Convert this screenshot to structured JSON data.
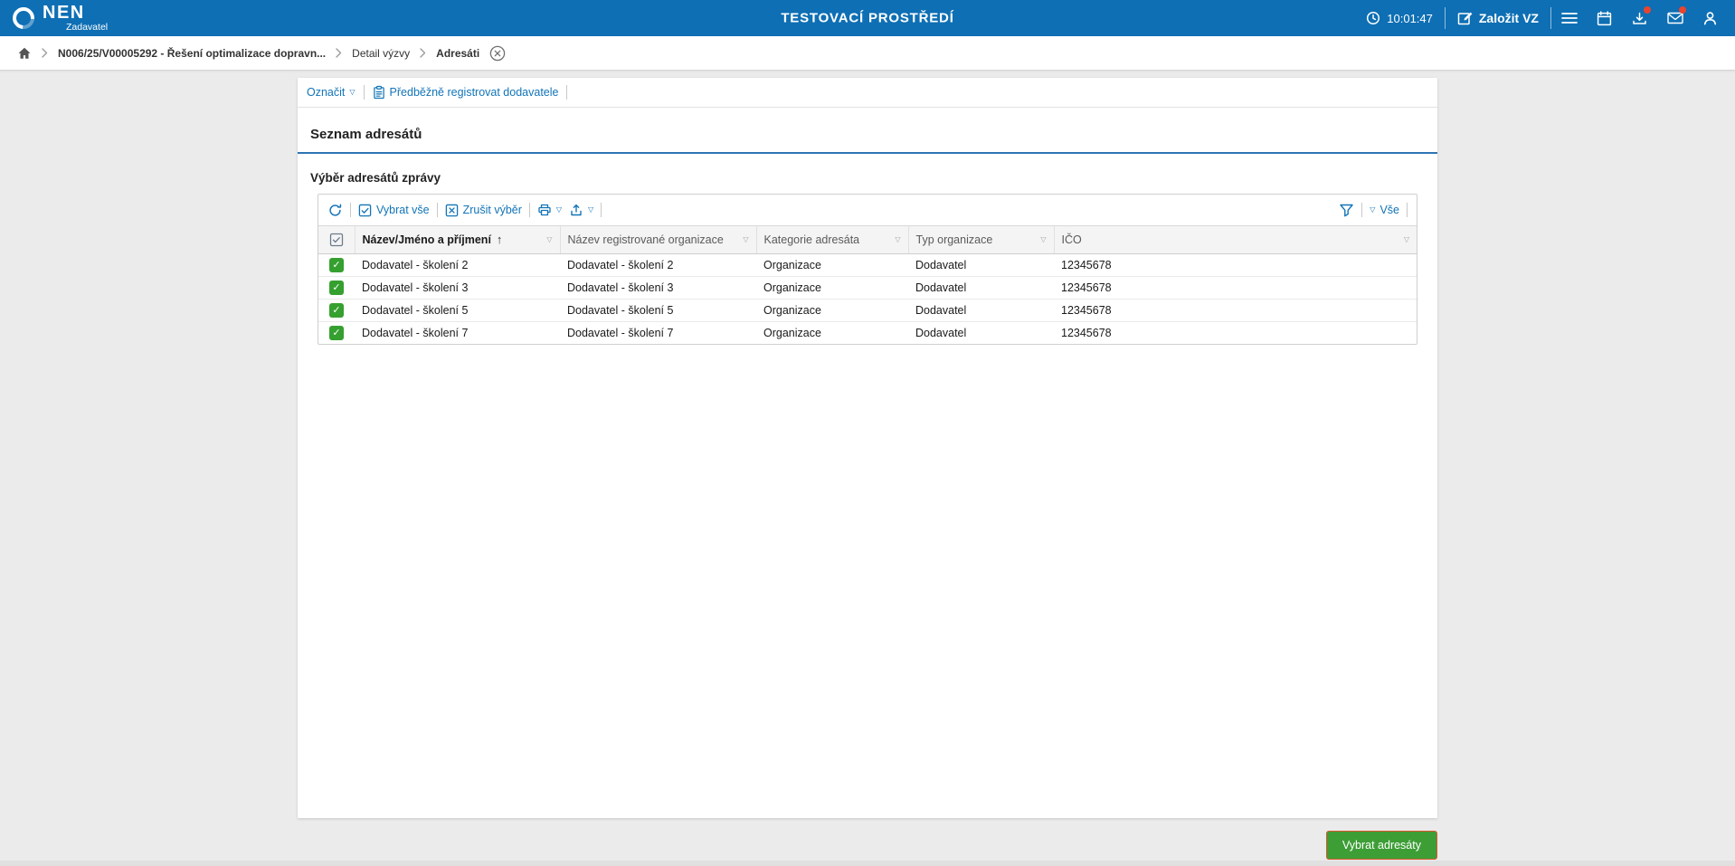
{
  "topbar": {
    "brand": "NEN",
    "brand_subtitle": "Zadavatel",
    "environment_title": "TESTOVACÍ PROSTŘEDÍ",
    "time": "10:01:47",
    "create_vz_label": "Založit VZ"
  },
  "breadcrumb": {
    "items": [
      "N006/25/V00005292 - Řešení optimalizace dopravn...",
      "Detail výzvy",
      "Adresáti"
    ]
  },
  "panel_toolbar": {
    "mark_label": "Označit",
    "preregister_label": "Předběžně registrovat dodavatele"
  },
  "page": {
    "section_title": "Seznam adresátů",
    "subsection_title": "Výběr adresátů zprávy"
  },
  "grid_toolbar": {
    "select_all_label": "Vybrat vše",
    "clear_selection_label": "Zrušit výběr",
    "filter_all_label": "Vše"
  },
  "table": {
    "columns": [
      "Název/Jméno a příjmení",
      "Název registrované organizace",
      "Kategorie adresáta",
      "Typ organizace",
      "IČO"
    ],
    "rows": [
      {
        "selected": true,
        "name": "Dodavatel - školení 2",
        "registered_org": "Dodavatel - školení 2",
        "category": "Organizace",
        "org_type": "Dodavatel",
        "ico": "12345678"
      },
      {
        "selected": true,
        "name": "Dodavatel - školení 3",
        "registered_org": "Dodavatel - školení 3",
        "category": "Organizace",
        "org_type": "Dodavatel",
        "ico": "12345678"
      },
      {
        "selected": true,
        "name": "Dodavatel - školení 5",
        "registered_org": "Dodavatel - školení 5",
        "category": "Organizace",
        "org_type": "Dodavatel",
        "ico": "12345678"
      },
      {
        "selected": true,
        "name": "Dodavatel - školení 7",
        "registered_org": "Dodavatel - školení 7",
        "category": "Organizace",
        "org_type": "Dodavatel",
        "ico": "12345678"
      }
    ]
  },
  "footer": {
    "select_recipients_label": "Vybrat adresáty"
  },
  "icons": {
    "caret_down": "▽",
    "check": "✓",
    "sort_ascending": "↑"
  },
  "colors": {
    "topbar_blue": "#0e6fb4",
    "link_blue": "#1274b8",
    "section_underline_blue": "#2e75b5",
    "checkbox_green": "#35a02f",
    "button_green": "#3d9e36",
    "button_border_orange": "#d9582e",
    "badge_red": "#e8442e"
  }
}
